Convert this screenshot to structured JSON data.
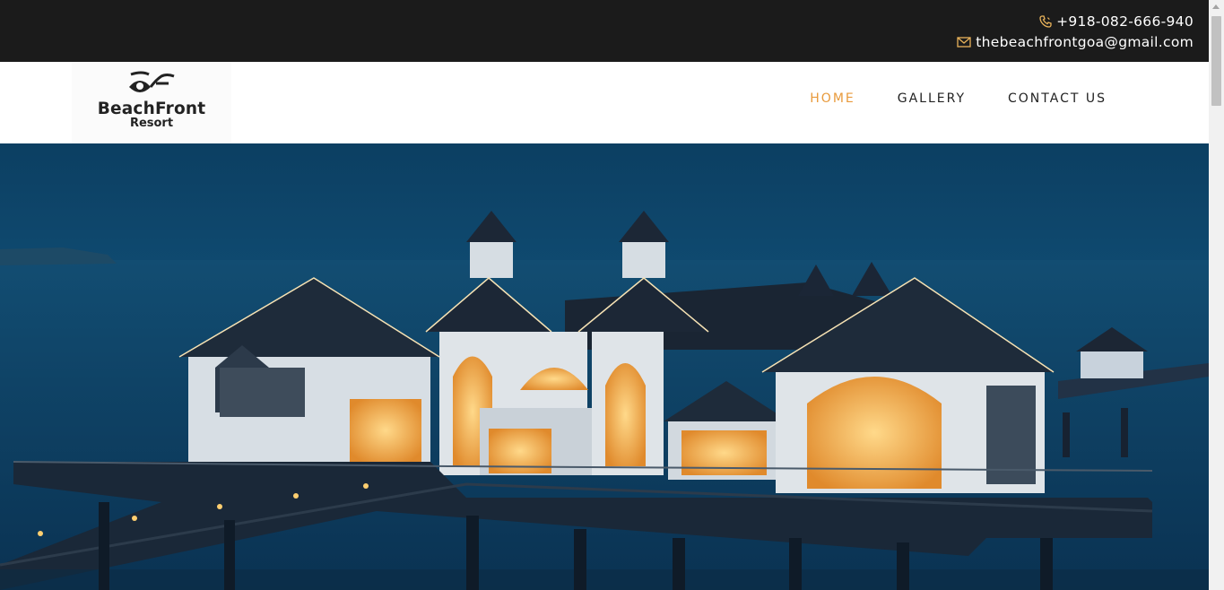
{
  "topbar": {
    "phone": "+918-082-666-940",
    "email": "thebeachfrontgoa@gmail.com",
    "phone_icon": "phone-icon",
    "email_icon": "envelope-icon"
  },
  "logo": {
    "name": "BeachFront",
    "sub": "Resort"
  },
  "nav": {
    "items": [
      {
        "label": "HOME",
        "active": true
      },
      {
        "label": "GALLERY",
        "active": false
      },
      {
        "label": "CONTACT US",
        "active": false
      }
    ]
  },
  "colors": {
    "topbar_bg": "#1b1b1b",
    "accent": "#e89a3c",
    "hero_sky": "#0e4569"
  }
}
